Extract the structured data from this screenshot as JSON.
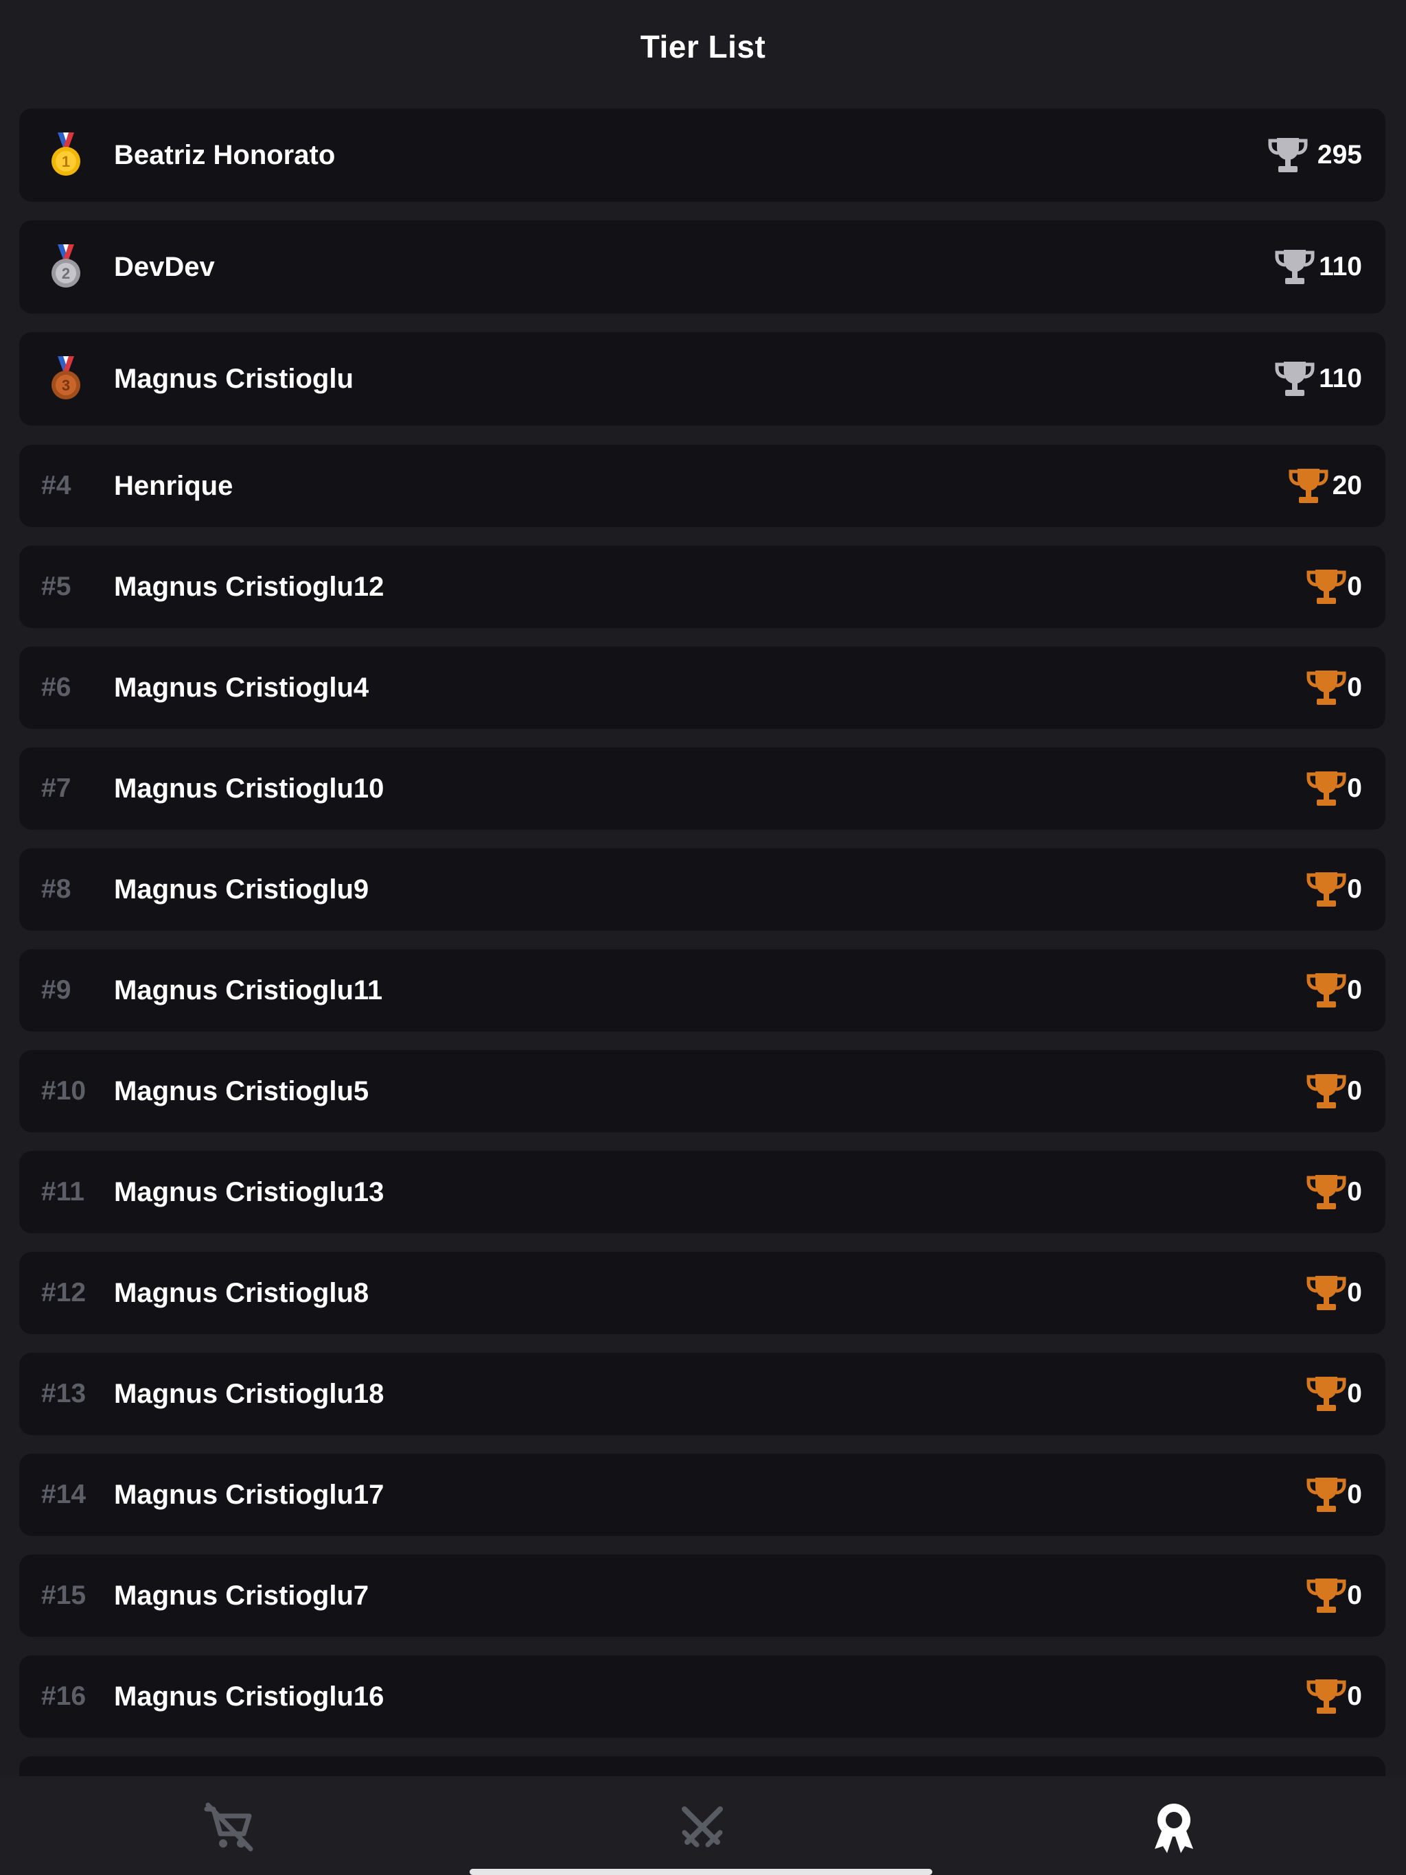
{
  "header": {
    "title": "Tier List"
  },
  "colors": {
    "background": "#1c1c21",
    "row_background": "#121216",
    "gold": "#f2b705",
    "silver_trophy": "#b9b9bf",
    "bronze_trophy": "#d7781f",
    "rank_text": "#5d5f66",
    "tab_inactive": "#5a5c63",
    "tab_active": "#ffffff"
  },
  "rows": [
    {
      "rank": "1",
      "medal": "gold-medal-icon",
      "name": "Beatriz Honorato",
      "trophy": "silver-trophy-icon",
      "score": "295"
    },
    {
      "rank": "2",
      "medal": "silver-medal-icon",
      "name": "DevDev",
      "trophy": "silver-trophy-icon",
      "score": "110"
    },
    {
      "rank": "3",
      "medal": "bronze-medal-icon",
      "name": "Magnus Cristioglu",
      "trophy": "silver-trophy-icon",
      "score": "110"
    },
    {
      "rank": "#4",
      "name": "Henrique",
      "trophy": "bronze-trophy-icon",
      "score": "20"
    },
    {
      "rank": "#5",
      "name": "Magnus Cristioglu12",
      "trophy": "bronze-trophy-icon",
      "score": "0"
    },
    {
      "rank": "#6",
      "name": "Magnus Cristioglu4",
      "trophy": "bronze-trophy-icon",
      "score": "0"
    },
    {
      "rank": "#7",
      "name": "Magnus Cristioglu10",
      "trophy": "bronze-trophy-icon",
      "score": "0"
    },
    {
      "rank": "#8",
      "name": "Magnus Cristioglu9",
      "trophy": "bronze-trophy-icon",
      "score": "0"
    },
    {
      "rank": "#9",
      "name": "Magnus Cristioglu11",
      "trophy": "bronze-trophy-icon",
      "score": "0"
    },
    {
      "rank": "#10",
      "name": "Magnus Cristioglu5",
      "trophy": "bronze-trophy-icon",
      "score": "0"
    },
    {
      "rank": "#11",
      "name": "Magnus Cristioglu13",
      "trophy": "bronze-trophy-icon",
      "score": "0"
    },
    {
      "rank": "#12",
      "name": "Magnus Cristioglu8",
      "trophy": "bronze-trophy-icon",
      "score": "0"
    },
    {
      "rank": "#13",
      "name": "Magnus Cristioglu18",
      "trophy": "bronze-trophy-icon",
      "score": "0"
    },
    {
      "rank": "#14",
      "name": "Magnus Cristioglu17",
      "trophy": "bronze-trophy-icon",
      "score": "0"
    },
    {
      "rank": "#15",
      "name": "Magnus Cristioglu7",
      "trophy": "bronze-trophy-icon",
      "score": "0"
    },
    {
      "rank": "#16",
      "name": "Magnus Cristioglu16",
      "trophy": "bronze-trophy-icon",
      "score": "0"
    }
  ],
  "tabbar": {
    "tabs": [
      {
        "icon": "shopping-cart-off-icon",
        "active": false
      },
      {
        "icon": "crossed-swords-icon",
        "active": false
      },
      {
        "icon": "award-ribbon-icon",
        "active": true
      }
    ]
  }
}
